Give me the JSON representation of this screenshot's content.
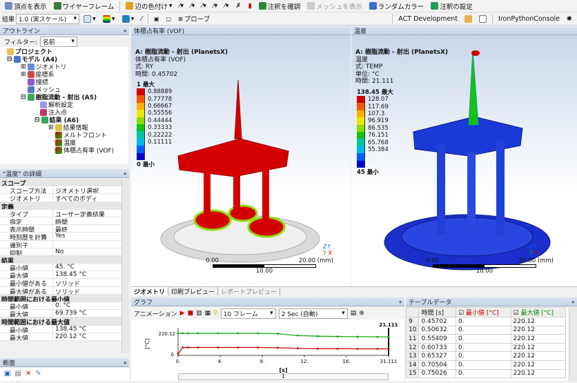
{
  "toolbar1": [
    {
      "label": "頂点を表示",
      "icon": "vertex-icon"
    },
    {
      "label": "ワイヤーフレーム",
      "icon": "wireframe-icon"
    },
    {
      "label": "辺の色付け",
      "icon": "edge-color-icon"
    },
    {
      "label": "注釈を確調",
      "icon": "annotation-icon"
    },
    {
      "label": "メッシュを表示",
      "icon": "mesh-icon",
      "disabled": true
    },
    {
      "label": "ランダムカラー",
      "icon": "random-color-icon"
    },
    {
      "label": "注釈の設定",
      "icon": "annotation-settings-icon"
    }
  ],
  "toolbar2": {
    "result_label": "結果",
    "scale_value": "1.0 (実スケール)",
    "probe_label": "プローブ",
    "act_label": "ACT Development",
    "ironpython_label": "IronPythonConsole"
  },
  "outline": {
    "title": "アウトライン",
    "filter_label": "フィルター:",
    "filter_value": "名前",
    "items": [
      {
        "label": "プロジェクト",
        "bold": true
      },
      {
        "label": "モデル (A4)",
        "bold": true
      },
      {
        "label": "ジオメトリ"
      },
      {
        "label": "座標系"
      },
      {
        "label": "接続"
      },
      {
        "label": "メッシュ"
      },
      {
        "label": "樹脂流動 - 射出 (A5)",
        "bold": true
      },
      {
        "label": "解析設定"
      },
      {
        "label": "注入点"
      },
      {
        "label": "結果 (A6)",
        "bold": true
      },
      {
        "label": "結果情報"
      },
      {
        "label": "メルトフロント"
      },
      {
        "label": "温度"
      },
      {
        "label": "体積占有率 (VOF)"
      }
    ]
  },
  "details": {
    "title": "\"温度\" の詳細",
    "rows": [
      {
        "k": "スコープ",
        "sec": true
      },
      {
        "k": "スコープ方法",
        "v": "ジオメトリ選択"
      },
      {
        "k": "ジオメトリ",
        "v": "すべてのボディ"
      },
      {
        "k": "定義",
        "sec": true
      },
      {
        "k": "タイプ",
        "v": "ユーザー定義結果"
      },
      {
        "k": "指定",
        "v": "時間"
      },
      {
        "k": "表示時間",
        "v": "最終"
      },
      {
        "k": "時刻歴を計算",
        "v": "Yes"
      },
      {
        "k": "識別子",
        "v": ""
      },
      {
        "k": "抑制",
        "v": "No"
      },
      {
        "k": "結果",
        "sec": true
      },
      {
        "k": "最小値",
        "v": "45. °C"
      },
      {
        "k": "最大値",
        "v": "138.45 °C"
      },
      {
        "k": "最小値があるパーツ",
        "v": "ソリッド"
      },
      {
        "k": "最大値があるパーツ",
        "v": "ソリッド"
      },
      {
        "k": "時間範囲における最小値",
        "sec": true
      },
      {
        "k": "最小値",
        "v": "0. °C"
      },
      {
        "k": "最大値",
        "v": "69.739 °C"
      },
      {
        "k": "時間範囲における最大値",
        "sec": true
      },
      {
        "k": "最小値",
        "v": "138.45 °C"
      },
      {
        "k": "最大値",
        "v": "220.12 °C"
      }
    ]
  },
  "section_panel": {
    "title": "断面"
  },
  "viewport_left": {
    "tab_title": "体積占有率 (VOF)",
    "lines": [
      "A: 樹脂流動 - 射出 (PlanetsX)",
      "体積占有率 (VOF)",
      "式: RY",
      "時間: 0.45702"
    ],
    "legend_title": "1 最大",
    "legend": [
      "0.88889",
      "0.77778",
      "0.66667",
      "0.55556",
      "0.44444",
      "0.33333",
      "0.22222",
      "0.11111"
    ],
    "legend_min": "0 最小",
    "colors": [
      "#d40000",
      "#f25a00",
      "#ffb000",
      "#e8e800",
      "#8edb00",
      "#18c018",
      "#00c8a0",
      "#00b8e8",
      "#0060ff",
      "#0000c8"
    ],
    "scale_left": "0.00",
    "scale_right": "20.00 (mm)",
    "scale_mid": "10.00"
  },
  "viewport_right": {
    "tab_title": "温度",
    "lines": [
      "A: 樹脂流動 - 射出 (PlanetsX)",
      "温度",
      "式: TEMP",
      "単位: °C",
      "時間: 21.111"
    ],
    "legend_title": "138.45 最大",
    "legend": [
      "128.07",
      "117.69",
      "107.3",
      "96.919",
      "86.535",
      "76.151",
      "65.768",
      "55.384"
    ],
    "legend_min": "45 最小",
    "colors": [
      "#d40000",
      "#f25a00",
      "#ffb000",
      "#e8e800",
      "#8edb00",
      "#18c018",
      "#00c8a0",
      "#00b8e8",
      "#0060ff",
      "#0000c8"
    ],
    "scale_left": "0.00",
    "scale_right": "20.00 (mm)",
    "scale_mid": "10.00"
  },
  "view_tabs": [
    "ジオメトリ",
    "印刷プレビュー",
    "レポートプレビュー"
  ],
  "graph": {
    "title": "グラフ",
    "anim_label": "アニメーション",
    "frames": "10 フレーム",
    "speed": "2 Sec (自動)",
    "time_marker": "21.111",
    "ylabel": "[°C]",
    "xlabel": "[s]",
    "page": "1",
    "yticks": [
      "220.12",
      "0."
    ],
    "xticks": [
      "0.",
      "4.",
      "8.",
      "12.",
      "16.",
      "21.111"
    ]
  },
  "chart_data": {
    "type": "line",
    "xlabel": "[s]",
    "ylabel": "[°C]",
    "xlim": [
      0,
      21.111
    ],
    "ylim": [
      0,
      220.12
    ],
    "series": [
      {
        "name": "最小値 [°C]",
        "color": "#c00000",
        "x": [
          0,
          0.457,
          1,
          2,
          4,
          6,
          8,
          10,
          12,
          14,
          16,
          18,
          20,
          21.111
        ],
        "values": [
          0,
          69.7,
          69.7,
          69.7,
          69.7,
          69.7,
          69.7,
          67,
          60,
          57,
          56,
          55,
          55,
          55
        ]
      },
      {
        "name": "最大値 [°C]",
        "color": "#00a000",
        "x": [
          0,
          0.457,
          1,
          2,
          4,
          6,
          8,
          10,
          12,
          14,
          16,
          18,
          20,
          21.111
        ],
        "values": [
          220.12,
          220.12,
          220.12,
          220.12,
          220.12,
          220.12,
          220.12,
          216,
          196,
          190,
          186,
          184,
          183,
          182
        ]
      }
    ]
  },
  "table": {
    "title": "テーブルデータ",
    "headers": [
      "時間 [s]",
      "最小値 [°C]",
      "最大値 [°C]"
    ],
    "rows": [
      [
        "9",
        "0.45702",
        "0.",
        "220.12"
      ],
      [
        "10",
        "0.50632",
        "0.",
        "220.12"
      ],
      [
        "11",
        "0.55409",
        "0.",
        "220.12"
      ],
      [
        "12",
        "0.60733",
        "0.",
        "220.12"
      ],
      [
        "13",
        "0.65327",
        "0.",
        "220.12"
      ],
      [
        "14",
        "0.70504",
        "0.",
        "220.12"
      ],
      [
        "15",
        "0.75026",
        "0.",
        "220.12"
      ]
    ]
  }
}
